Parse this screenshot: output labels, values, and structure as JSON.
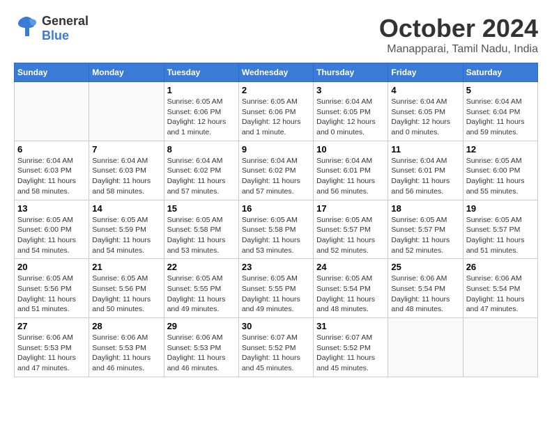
{
  "header": {
    "logo_general": "General",
    "logo_blue": "Blue",
    "month": "October 2024",
    "location": "Manapparai, Tamil Nadu, India"
  },
  "weekdays": [
    "Sunday",
    "Monday",
    "Tuesday",
    "Wednesday",
    "Thursday",
    "Friday",
    "Saturday"
  ],
  "weeks": [
    [
      {
        "day": "",
        "info": ""
      },
      {
        "day": "",
        "info": ""
      },
      {
        "day": "1",
        "info": "Sunrise: 6:05 AM\nSunset: 6:06 PM\nDaylight: 12 hours\nand 1 minute."
      },
      {
        "day": "2",
        "info": "Sunrise: 6:05 AM\nSunset: 6:06 PM\nDaylight: 12 hours\nand 1 minute."
      },
      {
        "day": "3",
        "info": "Sunrise: 6:04 AM\nSunset: 6:05 PM\nDaylight: 12 hours\nand 0 minutes."
      },
      {
        "day": "4",
        "info": "Sunrise: 6:04 AM\nSunset: 6:05 PM\nDaylight: 12 hours\nand 0 minutes."
      },
      {
        "day": "5",
        "info": "Sunrise: 6:04 AM\nSunset: 6:04 PM\nDaylight: 11 hours\nand 59 minutes."
      }
    ],
    [
      {
        "day": "6",
        "info": "Sunrise: 6:04 AM\nSunset: 6:03 PM\nDaylight: 11 hours\nand 58 minutes."
      },
      {
        "day": "7",
        "info": "Sunrise: 6:04 AM\nSunset: 6:03 PM\nDaylight: 11 hours\nand 58 minutes."
      },
      {
        "day": "8",
        "info": "Sunrise: 6:04 AM\nSunset: 6:02 PM\nDaylight: 11 hours\nand 57 minutes."
      },
      {
        "day": "9",
        "info": "Sunrise: 6:04 AM\nSunset: 6:02 PM\nDaylight: 11 hours\nand 57 minutes."
      },
      {
        "day": "10",
        "info": "Sunrise: 6:04 AM\nSunset: 6:01 PM\nDaylight: 11 hours\nand 56 minutes."
      },
      {
        "day": "11",
        "info": "Sunrise: 6:04 AM\nSunset: 6:01 PM\nDaylight: 11 hours\nand 56 minutes."
      },
      {
        "day": "12",
        "info": "Sunrise: 6:05 AM\nSunset: 6:00 PM\nDaylight: 11 hours\nand 55 minutes."
      }
    ],
    [
      {
        "day": "13",
        "info": "Sunrise: 6:05 AM\nSunset: 6:00 PM\nDaylight: 11 hours\nand 54 minutes."
      },
      {
        "day": "14",
        "info": "Sunrise: 6:05 AM\nSunset: 5:59 PM\nDaylight: 11 hours\nand 54 minutes."
      },
      {
        "day": "15",
        "info": "Sunrise: 6:05 AM\nSunset: 5:58 PM\nDaylight: 11 hours\nand 53 minutes."
      },
      {
        "day": "16",
        "info": "Sunrise: 6:05 AM\nSunset: 5:58 PM\nDaylight: 11 hours\nand 53 minutes."
      },
      {
        "day": "17",
        "info": "Sunrise: 6:05 AM\nSunset: 5:57 PM\nDaylight: 11 hours\nand 52 minutes."
      },
      {
        "day": "18",
        "info": "Sunrise: 6:05 AM\nSunset: 5:57 PM\nDaylight: 11 hours\nand 52 minutes."
      },
      {
        "day": "19",
        "info": "Sunrise: 6:05 AM\nSunset: 5:57 PM\nDaylight: 11 hours\nand 51 minutes."
      }
    ],
    [
      {
        "day": "20",
        "info": "Sunrise: 6:05 AM\nSunset: 5:56 PM\nDaylight: 11 hours\nand 51 minutes."
      },
      {
        "day": "21",
        "info": "Sunrise: 6:05 AM\nSunset: 5:56 PM\nDaylight: 11 hours\nand 50 minutes."
      },
      {
        "day": "22",
        "info": "Sunrise: 6:05 AM\nSunset: 5:55 PM\nDaylight: 11 hours\nand 49 minutes."
      },
      {
        "day": "23",
        "info": "Sunrise: 6:05 AM\nSunset: 5:55 PM\nDaylight: 11 hours\nand 49 minutes."
      },
      {
        "day": "24",
        "info": "Sunrise: 6:05 AM\nSunset: 5:54 PM\nDaylight: 11 hours\nand 48 minutes."
      },
      {
        "day": "25",
        "info": "Sunrise: 6:06 AM\nSunset: 5:54 PM\nDaylight: 11 hours\nand 48 minutes."
      },
      {
        "day": "26",
        "info": "Sunrise: 6:06 AM\nSunset: 5:54 PM\nDaylight: 11 hours\nand 47 minutes."
      }
    ],
    [
      {
        "day": "27",
        "info": "Sunrise: 6:06 AM\nSunset: 5:53 PM\nDaylight: 11 hours\nand 47 minutes."
      },
      {
        "day": "28",
        "info": "Sunrise: 6:06 AM\nSunset: 5:53 PM\nDaylight: 11 hours\nand 46 minutes."
      },
      {
        "day": "29",
        "info": "Sunrise: 6:06 AM\nSunset: 5:53 PM\nDaylight: 11 hours\nand 46 minutes."
      },
      {
        "day": "30",
        "info": "Sunrise: 6:07 AM\nSunset: 5:52 PM\nDaylight: 11 hours\nand 45 minutes."
      },
      {
        "day": "31",
        "info": "Sunrise: 6:07 AM\nSunset: 5:52 PM\nDaylight: 11 hours\nand 45 minutes."
      },
      {
        "day": "",
        "info": ""
      },
      {
        "day": "",
        "info": ""
      }
    ]
  ]
}
